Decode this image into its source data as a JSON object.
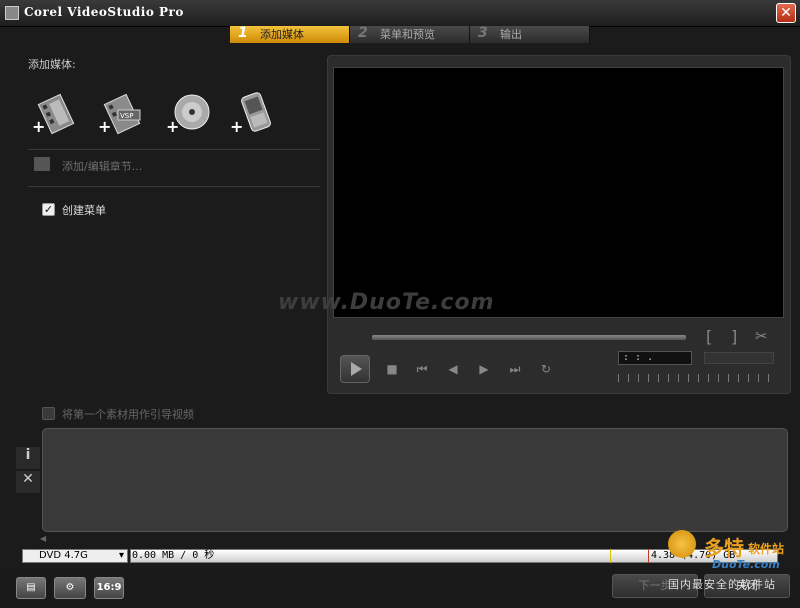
{
  "window": {
    "title": "Corel VideoStudio Pro"
  },
  "steps": [
    {
      "num": "1",
      "label": "添加媒体"
    },
    {
      "num": "2",
      "label": "菜单和预览"
    },
    {
      "num": "3",
      "label": "输出"
    }
  ],
  "left": {
    "add_media_label": "添加媒体:",
    "chapter_label": "添加/编辑章节...",
    "create_menu_label": "创建菜单",
    "intro_video_label": "将第一个素材用作引导视频"
  },
  "preview": {
    "watermark": "www.DuoTe.com",
    "timecode": " :  :  . ",
    "mark_in": "[",
    "mark_out": "]"
  },
  "disc": {
    "selected": "DVD 4.7G",
    "usage": "0.00 MB / 0 秒",
    "capacity": "4.38 (4.70) GB"
  },
  "bottom": {
    "next_label": "下一步",
    "close_label": "关闭",
    "aspect_label": "16:9"
  },
  "logo": {
    "cn": "多特",
    "sub": "软件站",
    "url": "DuoTe.com",
    "tag": "国内最安全的软件站"
  },
  "colors": {
    "active_step": "#f3c33a",
    "background": "#1b1b1b"
  }
}
